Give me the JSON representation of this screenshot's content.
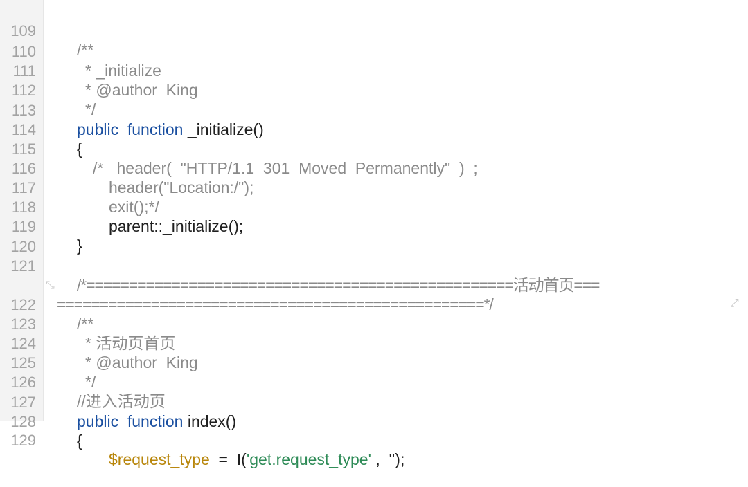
{
  "editor": {
    "lines": [
      {
        "num": "109",
        "text": "/**"
      },
      {
        "num": "110",
        "text": "* _initialize"
      },
      {
        "num": "111",
        "text": "* @author  King"
      },
      {
        "num": "112",
        "text": "*/"
      },
      {
        "num": "113",
        "kw": "public  function",
        "rest": " _initialize()"
      },
      {
        "num": "114",
        "text": "{"
      },
      {
        "num": "115",
        "text": "/*   header(  \"HTTP/1.1  301  Moved  Permanently\"  )  ;"
      },
      {
        "num": "116",
        "text": "header(\"Location:/\");"
      },
      {
        "num": "117",
        "text": "exit();*/"
      },
      {
        "num": "118",
        "text": "parent::_initialize();"
      },
      {
        "num": "119",
        "text": "}"
      },
      {
        "num": "120",
        "text": ""
      },
      {
        "num": "121",
        "text": "/*==================================================活动首页===",
        "wrap": "==================================================*/"
      },
      {
        "num": "122",
        "text": "/**"
      },
      {
        "num": "123",
        "text": "* 活动页首页"
      },
      {
        "num": "124",
        "text": "* @author  King"
      },
      {
        "num": "125",
        "text": "*/"
      },
      {
        "num": "126",
        "text": "//进入活动页"
      },
      {
        "num": "127",
        "kw": "public  function",
        "rest": " index()"
      },
      {
        "num": "128",
        "text": "{"
      },
      {
        "num": "129",
        "var": "$request_type",
        "mid": "  =  I(",
        "str": "'get.request_type'",
        "end": " ,  '');"
      }
    ]
  },
  "icons": {
    "wrap_start": "wrap-arrow-icon",
    "wrap_end": "wrap-return-icon"
  },
  "colors": {
    "keyword": "#1a4fa0",
    "comment": "#8a8a8a",
    "line_number": "#a3a3a3",
    "gutter_bg": "#f3f3f3"
  }
}
